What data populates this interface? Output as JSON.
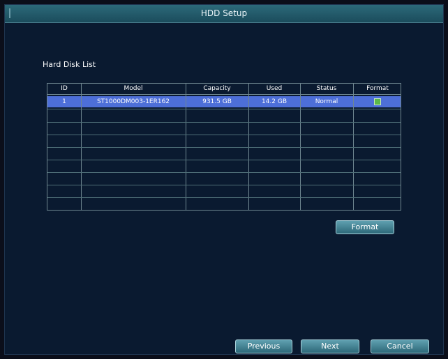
{
  "window": {
    "title": "HDD Setup"
  },
  "section": {
    "label": "Hard Disk List"
  },
  "table": {
    "columns": [
      "ID",
      "Model",
      "Capacity",
      "Used",
      "Status",
      "Format"
    ],
    "rows": [
      [
        "1",
        "ST1000DM003-1ER162",
        "931.5 GB",
        "14.2 GB",
        "Normal",
        ""
      ]
    ]
  },
  "buttons": {
    "format": "Format",
    "previous": "Previous",
    "next": "Next",
    "cancel": "Cancel"
  },
  "colors": {
    "selected_row": "#4d6fd8",
    "background": "#0a1a30",
    "button": "#3f8494"
  }
}
